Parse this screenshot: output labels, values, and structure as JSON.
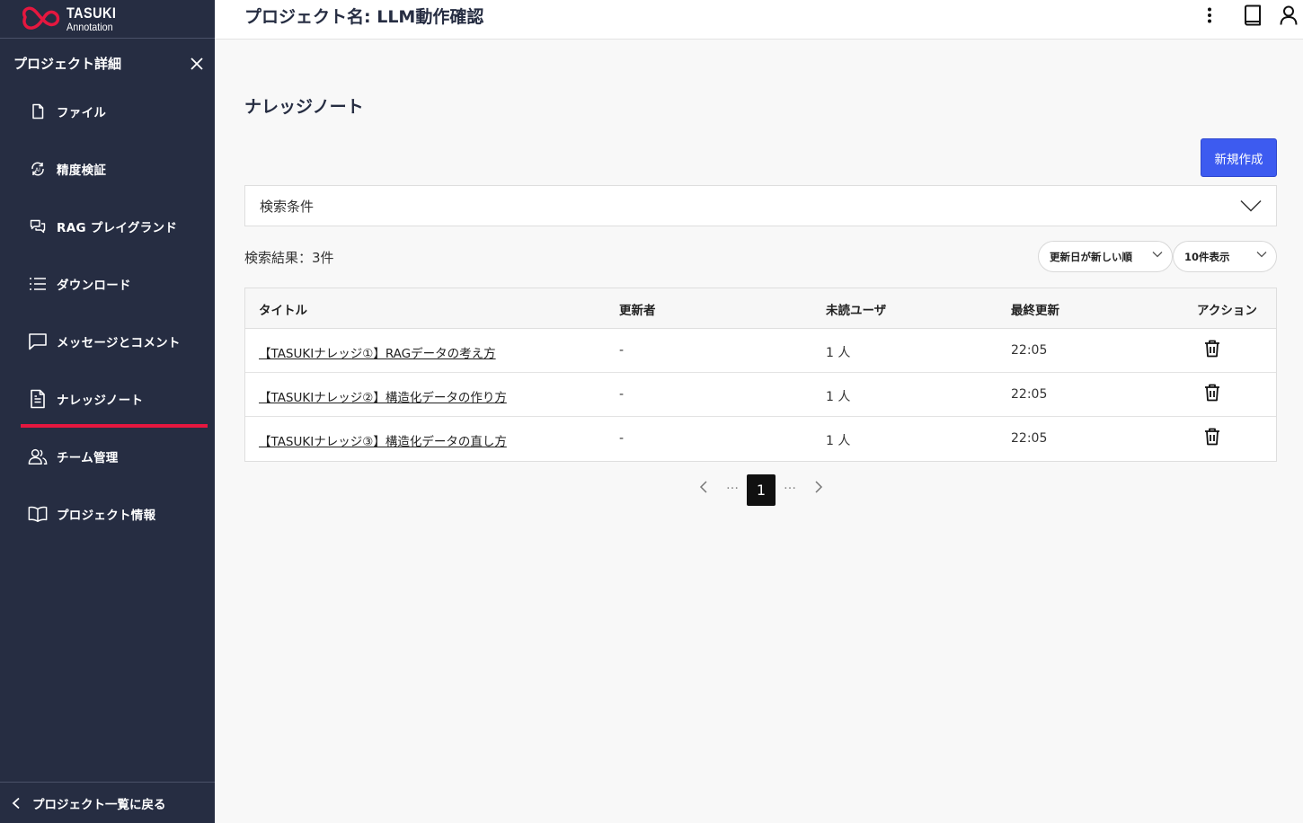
{
  "app": {
    "logo_title": "TASUKI",
    "logo_sub": "Annotation",
    "accent": "#e5173f",
    "sidebar_bg": "#262d42",
    "primary": "#3d5bf0"
  },
  "header": {
    "project_title": "プロジェクト名: LLM動作確認"
  },
  "sidebar": {
    "title": "プロジェクト詳細",
    "items": [
      {
        "label": "ファイル",
        "icon": "file-icon"
      },
      {
        "label": "精度検証",
        "icon": "accuracy-icon"
      },
      {
        "label": "RAG プレイグランド",
        "icon": "chat-bubbles-icon"
      },
      {
        "label": "ダウンロード",
        "icon": "list-icon"
      },
      {
        "label": "メッセージとコメント",
        "icon": "message-icon"
      },
      {
        "label": "ナレッジノート",
        "icon": "note-icon",
        "active": true
      },
      {
        "label": "チーム管理",
        "icon": "team-icon"
      },
      {
        "label": "プロジェクト情報",
        "icon": "book-open-icon"
      }
    ],
    "back_label": "プロジェクト一覧に戻る"
  },
  "main": {
    "heading": "ナレッジノート",
    "new_button": "新規作成",
    "search_label": "検索条件",
    "result_count": "検索結果：3件",
    "sort_select": "更新日が新しい順",
    "count_select": "10件表示",
    "columns": [
      "タイトル",
      "更新者",
      "未読ユーザ",
      "最終更新",
      "アクション"
    ],
    "rows": [
      {
        "title": "【TASUKIナレッジ①】RAGデータの考え方",
        "updater": "-",
        "unread": "1 人",
        "updated": "22:05"
      },
      {
        "title": "【TASUKIナレッジ②】構造化データの作り方",
        "updater": "-",
        "unread": "1 人",
        "updated": "22:05"
      },
      {
        "title": "【TASUKIナレッジ③】構造化データの直し方",
        "updater": "-",
        "unread": "1 人",
        "updated": "22:05"
      }
    ],
    "pagination": {
      "current": "1",
      "dots": "…"
    }
  }
}
